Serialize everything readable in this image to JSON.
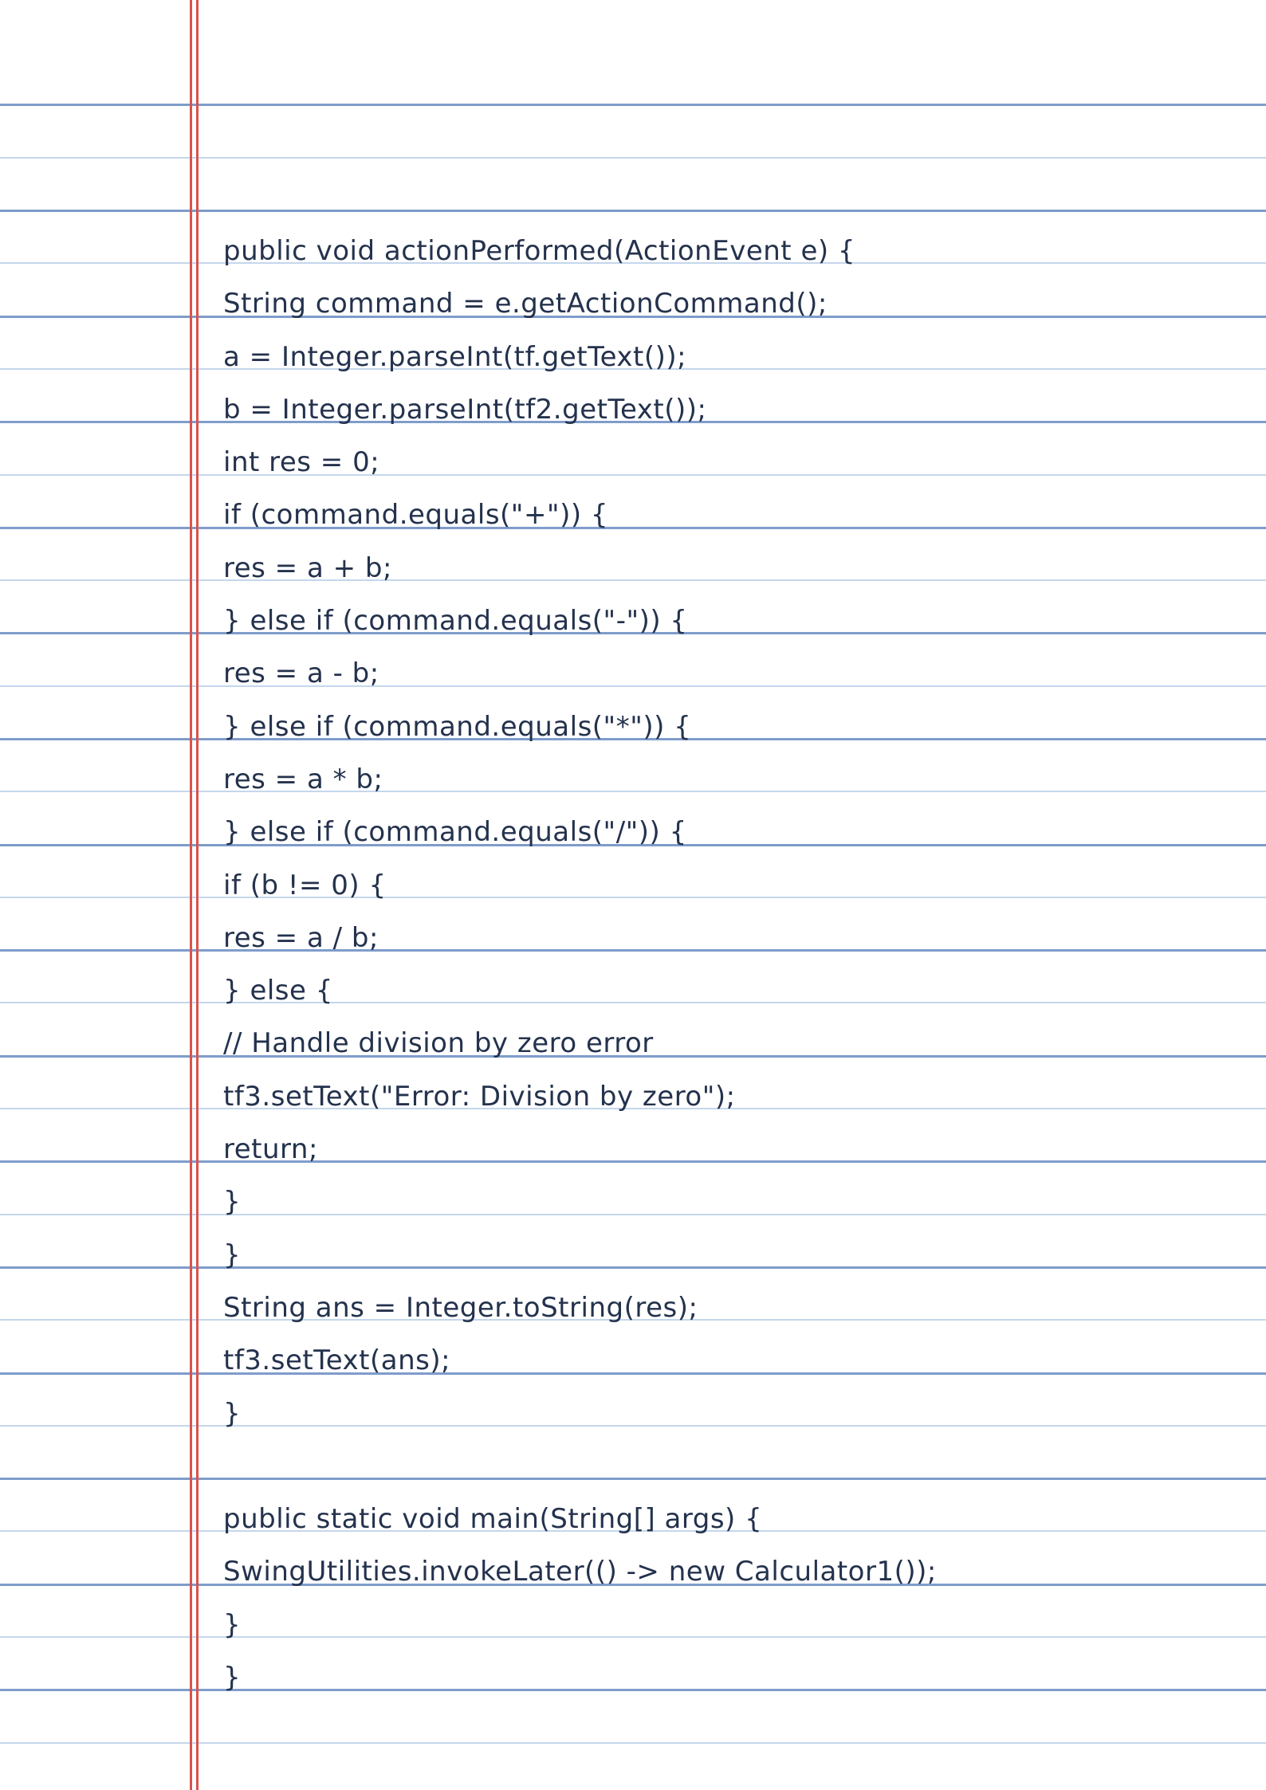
{
  "page": {
    "paper_colors": {
      "background": "#ffffff",
      "light_rule": "#c4d7ec",
      "dark_rule": "#7f9ccb",
      "margin_line": "#d9534f",
      "ink": "#24324d"
    }
  },
  "code_lines": [
    "public void actionPerformed(ActionEvent e) {",
    "String command = e.getActionCommand();",
    "a = Integer.parseInt(tf.getText());",
    "b = Integer.parseInt(tf2.getText());",
    "int res = 0;",
    "if (command.equals(\"+\")) {",
    "res = a + b;",
    "} else if (command.equals(\"-\")) {",
    "res = a - b;",
    "} else if (command.equals(\"*\")) {",
    "res = a * b;",
    "} else if (command.equals(\"/\")) {",
    "if (b != 0) {",
    "res = a / b;",
    "} else {",
    "// Handle division by zero error",
    "tf3.setText(\"Error: Division by zero\");",
    "return;",
    "}",
    "}",
    "String ans = Integer.toString(res);",
    "tf3.setText(ans);",
    "}",
    "",
    "public static void main(String[] args) {",
    "SwingUtilities.invokeLater(() -> new Calculator1());",
    "}",
    "}"
  ]
}
